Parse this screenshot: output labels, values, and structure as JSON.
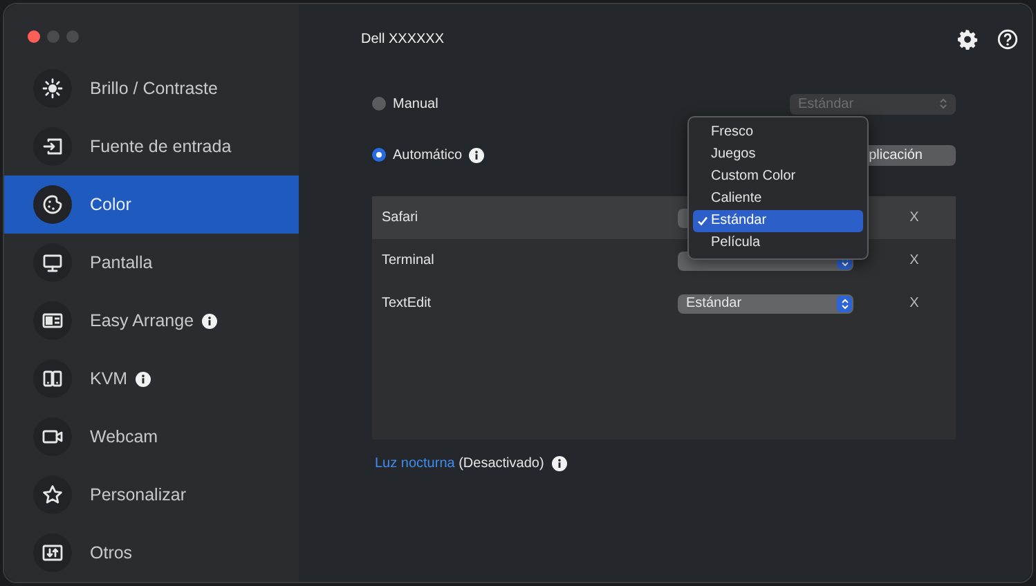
{
  "window": {
    "title": "Dell XXXXXX"
  },
  "sidebar": {
    "items": [
      {
        "label": "Brillo / Contraste",
        "kind": "brightness",
        "selected": false,
        "info": false
      },
      {
        "label": "Fuente de entrada",
        "kind": "input",
        "selected": false,
        "info": false
      },
      {
        "label": "Color",
        "kind": "palette",
        "selected": true,
        "info": false
      },
      {
        "label": "Pantalla",
        "kind": "monitor",
        "selected": false,
        "info": false
      },
      {
        "label": "Easy Arrange",
        "kind": "arrange",
        "selected": false,
        "info": true
      },
      {
        "label": "KVM",
        "kind": "kvm",
        "selected": false,
        "info": true
      },
      {
        "label": "Webcam",
        "kind": "webcam",
        "selected": false,
        "info": false
      },
      {
        "label": "Personalizar",
        "kind": "star",
        "selected": false,
        "info": false
      },
      {
        "label": "Otros",
        "kind": "others",
        "selected": false,
        "info": false
      }
    ]
  },
  "color_mode": {
    "options": [
      {
        "label": "Manual",
        "selected": false,
        "info": false
      },
      {
        "label": "Automático",
        "selected": true,
        "info": true
      }
    ],
    "manual_preset": {
      "value": "Estándar",
      "disabled": true
    },
    "app_button": {
      "label": "plicación"
    }
  },
  "apps": {
    "rows": [
      {
        "name": "Safari",
        "selected": true,
        "remove": "X"
      },
      {
        "name": "Terminal",
        "selected": false,
        "remove": "X"
      },
      {
        "name": "TextEdit",
        "selected": false,
        "preset": "Estándar",
        "remove": "X"
      }
    ]
  },
  "preset_menu": {
    "items": [
      {
        "label": "Fresco",
        "selected": false
      },
      {
        "label": "Juegos",
        "selected": false
      },
      {
        "label": "Custom Color",
        "selected": false
      },
      {
        "label": "Caliente",
        "selected": false
      },
      {
        "label": "Estándar",
        "selected": true
      },
      {
        "label": "Película",
        "selected": false
      }
    ]
  },
  "night_light": {
    "link": "Luz nocturna",
    "status": "(Desactivado)",
    "info": true
  }
}
